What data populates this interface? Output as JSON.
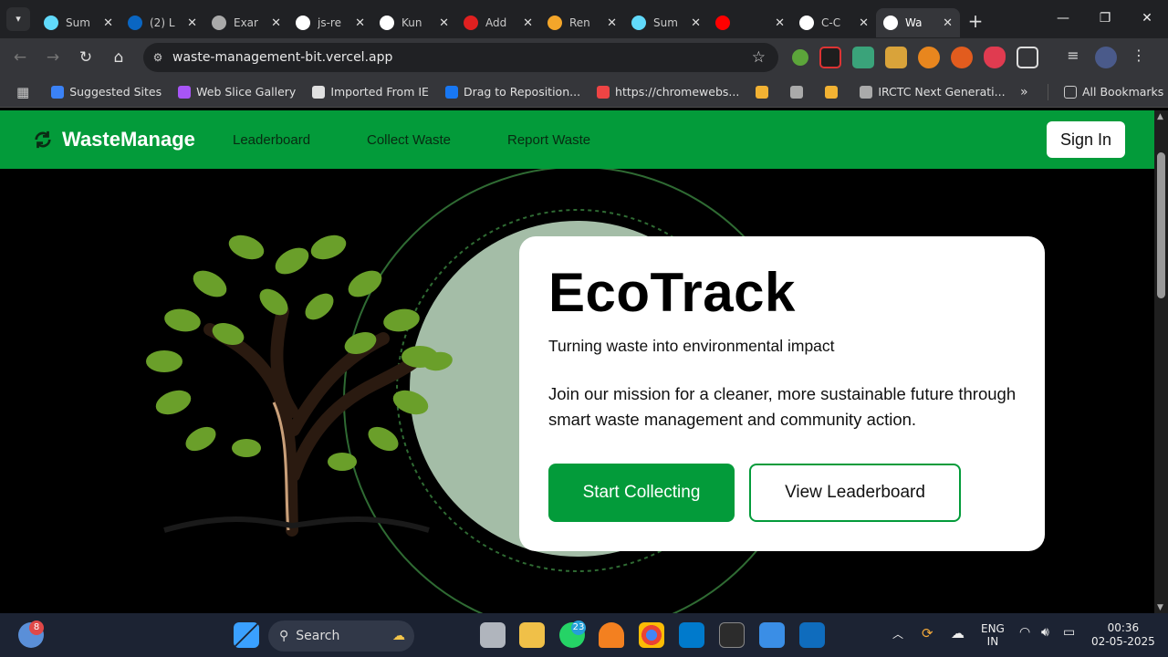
{
  "browser": {
    "tabs": [
      {
        "title": "Sum",
        "icon": "react-icon",
        "color": "#61dafb"
      },
      {
        "title": "(2) L",
        "icon": "linkedin-icon",
        "color": "#0a66c2"
      },
      {
        "title": "Exar",
        "icon": "globe-icon",
        "color": "#aaaaaa"
      },
      {
        "title": "js-re",
        "icon": "github-icon",
        "color": "#ffffff"
      },
      {
        "title": "Kun",
        "icon": "openai-icon",
        "color": "#ffffff"
      },
      {
        "title": "Add",
        "icon": "flipkart-icon",
        "color": "#e02020"
      },
      {
        "title": "Ren",
        "icon": "stack-icon",
        "color": "#f4a62a"
      },
      {
        "title": "Sum",
        "icon": "react-icon",
        "color": "#61dafb"
      },
      {
        "title": "",
        "icon": "youtube-icon",
        "color": "#ff0000"
      },
      {
        "title": "C-C",
        "icon": "github-icon",
        "color": "#ffffff"
      },
      {
        "title": "Wa",
        "icon": "vercel-icon",
        "color": "#ffffff"
      }
    ],
    "url": "waste-management-bit.vercel.app",
    "bookmarks": [
      {
        "label": "Suggested Sites",
        "color": "#3b82f6"
      },
      {
        "label": "Web Slice Gallery",
        "color": "#a855f7"
      },
      {
        "label": "Imported From IE",
        "color": "#e0e0e0"
      },
      {
        "label": "Drag to Reposition...",
        "color": "#1877f2"
      },
      {
        "label": "https://chromewebs...",
        "color": "#e44"
      },
      {
        "label": "",
        "color": "#f2b233"
      },
      {
        "label": "",
        "color": "#aaaaaa"
      },
      {
        "label": "",
        "color": "#f2b233"
      },
      {
        "label": "IRCTC Next Generati...",
        "color": "#aaaaaa"
      }
    ],
    "all_bookmarks": "All Bookmarks"
  },
  "site": {
    "brand": "WasteManage",
    "nav": [
      "Leaderboard",
      "Collect Waste",
      "Report Waste"
    ],
    "sign_in": "Sign In",
    "accent": "#039b3a"
  },
  "hero": {
    "title": "EcoTrack",
    "subtitle": "Turning waste into environmental impact",
    "description": "Join our mission for a cleaner, more sustainable future through smart waste management and community action.",
    "primary_cta": "Start Collecting",
    "secondary_cta": "View Leaderboard"
  },
  "taskbar": {
    "search_label": "Search",
    "weather_badge": "8",
    "whatsapp_badge": "23",
    "lang_line1": "ENG",
    "lang_line2": "IN",
    "time": "00:36",
    "date": "02-05-2025"
  }
}
